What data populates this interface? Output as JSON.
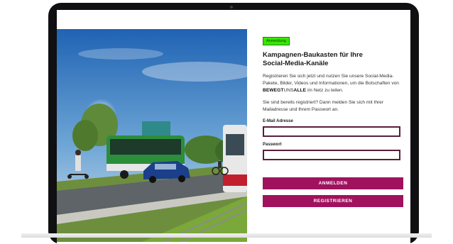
{
  "hero": {
    "description_icon": "transit-scene-image"
  },
  "form": {
    "badge": "Anmeldung",
    "title": "Kampagnen-Baukasten für Ihre Social-Media-Kanäle",
    "intro_part1": "Registrieren Sie sich jetzt und nutzen Sie unsere Social-Media-Pakete, Bilder, Videos und Informationen, um die Botschaften von",
    "brand_a": "BEWEGT",
    "brand_b": "UNS",
    "brand_c": "ALLE",
    "intro_part2": "im Netz zu teilen.",
    "login_hint": "Sie sind bereits registriert? Dann melden Sie sich mit Ihrer Mailadresse und Ihrem Passwort an.",
    "email_label": "E-Mail Adresse",
    "password_label": "Passwort",
    "login_button": "ANMELDEN",
    "register_button": "REGISTRIEREN"
  },
  "colors": {
    "accent": "#a0125e",
    "badge": "#39e600",
    "input_border": "#5a1e3c"
  }
}
